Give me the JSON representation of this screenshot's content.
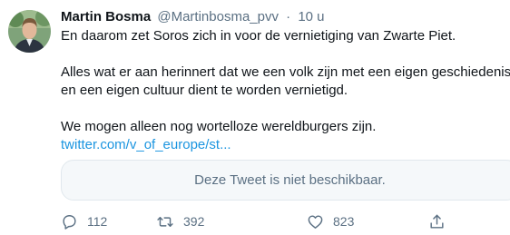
{
  "author": {
    "name": "Martin Bosma",
    "handle": "@Martinbosma_pvv",
    "separator": "·",
    "time": "10 u"
  },
  "tweet": {
    "lines": [
      "En daarom zet Soros zich in voor de vernietiging van Zwarte Piet.",
      "Alles wat er aan herinnert dat we een volk zijn met een eigen geschiedenis",
      "en een eigen cultuur dient te worden vernietigd.",
      "We mogen alleen nog wortelloze wereldburgers zijn."
    ],
    "link": "twitter.com/v_of_europe/st..."
  },
  "quoted_tweet": {
    "message": "Deze Tweet is niet beschikbaar."
  },
  "actions": {
    "replies": "112",
    "retweets": "392",
    "likes": "823"
  },
  "colors": {
    "text": "#0f1419",
    "secondary": "#5b7083",
    "link": "#1b95e0",
    "quote_bg": "#f5f8fa",
    "quote_border": "#e1e8ed"
  },
  "icons": [
    "reply-icon",
    "retweet-icon",
    "like-icon",
    "share-icon"
  ]
}
